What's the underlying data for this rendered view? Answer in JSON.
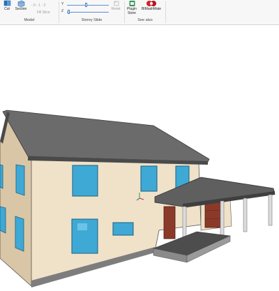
{
  "ribbon": {
    "model_group": {
      "label": "Model",
      "cut_label": "Cut",
      "section_label": "Section",
      "slice_values": "- 0 - 1 - 2",
      "fill_slice_label": "Fill Slice"
    },
    "storey_slide_group": {
      "label": "Storey Slide",
      "y_axis": "Y",
      "z_axis": "Z",
      "reset_label": "Reset",
      "y_level": 0.45,
      "z_level": 0.02
    },
    "see_also_group": {
      "label": "See also",
      "plugin_store_label": "Plugin\nStore",
      "bimashmate_label": "BIMashMate"
    }
  },
  "icons": {
    "cut": "scissors-icon",
    "section": "section-cube-icon",
    "reset": "reset-icon",
    "plugin_store": "plugin-store-icon",
    "bimashmate": "bimashmate-logo-icon"
  },
  "colors": {
    "ribbon_bg": "#f7f7f7",
    "wall": "#f0e2c8",
    "wall_shadow": "#d9c6a6",
    "roof": "#6b6b6b",
    "window_glass": "#3fa9d6",
    "door": "#8b3a2a",
    "accent_blue": "#1e6fd0"
  }
}
